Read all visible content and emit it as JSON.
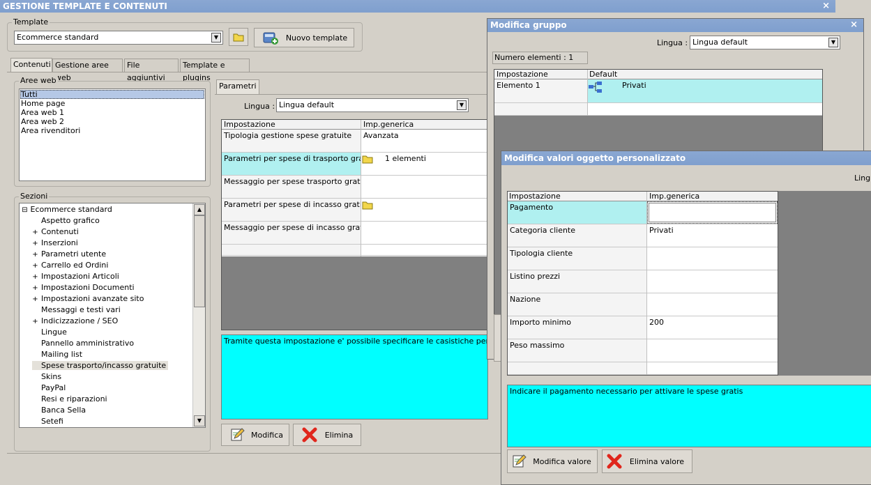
{
  "main": {
    "title": "GESTIONE TEMPLATE E CONTENUTI",
    "close": "×",
    "template_group_label": "Template",
    "template_value": "Ecommerce standard",
    "new_template_label": "Nuovo template",
    "tabs": [
      "Contenuti",
      "Gestione aree web",
      "File aggiuntivi",
      "Template e plugins"
    ],
    "aree_web_label": "Aree web",
    "aree_web": [
      "Tutti",
      "Home page",
      "Area web 1",
      "Area web 2",
      "Area rivenditori"
    ],
    "sezioni_label": "Sezioni",
    "tree_root": "Ecommerce standard",
    "tree": [
      {
        "label": "Aspetto grafico",
        "expandable": false
      },
      {
        "label": "Contenuti",
        "expandable": true
      },
      {
        "label": "Inserzioni",
        "expandable": true
      },
      {
        "label": "Parametri utente",
        "expandable": true
      },
      {
        "label": "Carrello ed Ordini",
        "expandable": true
      },
      {
        "label": "Impostazioni Articoli",
        "expandable": true
      },
      {
        "label": "Impostazioni Documenti",
        "expandable": true
      },
      {
        "label": "Impostazioni avanzate sito",
        "expandable": true
      },
      {
        "label": "Messaggi e testi vari",
        "expandable": false
      },
      {
        "label": "Indicizzazione / SEO",
        "expandable": true
      },
      {
        "label": "Lingue",
        "expandable": false
      },
      {
        "label": "Pannello amministrativo",
        "expandable": false
      },
      {
        "label": "Mailing list",
        "expandable": false
      },
      {
        "label": "Spese trasporto/incasso gratuite",
        "expandable": false
      },
      {
        "label": "Skins",
        "expandable": false
      },
      {
        "label": "PayPal",
        "expandable": false
      },
      {
        "label": "Resi e riparazioni",
        "expandable": false
      },
      {
        "label": "Banca Sella",
        "expandable": false
      },
      {
        "label": "Setefi",
        "expandable": false
      }
    ],
    "param_tab": "Parametri",
    "lingua_label": "Lingua :",
    "lingua_value": "Lingua default",
    "grid_headers": [
      "Impostazione",
      "Imp.generica"
    ],
    "grid_rows": [
      {
        "name": "Tipologia gestione spese gratuite",
        "value": "Avanzata"
      },
      {
        "name": "Parametri per spese di trasporto gratis",
        "value": "1 elementi"
      },
      {
        "name": "Messaggio per spese trasporto gratis",
        "value": ""
      },
      {
        "name": "Parametri per spese di incasso gratis",
        "value": ""
      },
      {
        "name": "Messaggio per spese di incasso gratis",
        "value": ""
      }
    ],
    "description": "Tramite questa impostazione e' possibile specificare le casistiche per l'attivazion",
    "modifica_label": "Modifica",
    "elimina_label": "Elimina"
  },
  "gruppo": {
    "title": "Modifica gruppo",
    "close": "×",
    "lingua_label": "Lingua :",
    "lingua_value": "Lingua default",
    "count_label": "Numero elementi : 1",
    "headers": [
      "Impostazione",
      "Default"
    ],
    "rows": [
      {
        "name": "Elemento 1",
        "value": "Privati"
      }
    ]
  },
  "oggetto": {
    "title": "Modifica valori oggetto personalizzato",
    "lingua_partial": "Lingu",
    "headers": [
      "Impostazione",
      "Imp.generica"
    ],
    "rows": [
      {
        "name": "Pagamento",
        "value": ""
      },
      {
        "name": "Categoria cliente",
        "value": "Privati"
      },
      {
        "name": "Tipologia cliente",
        "value": ""
      },
      {
        "name": "Listino prezzi",
        "value": ""
      },
      {
        "name": "Nazione",
        "value": ""
      },
      {
        "name": "Importo minimo",
        "value": "200"
      },
      {
        "name": "Peso massimo",
        "value": ""
      }
    ],
    "description": "Indicare il pagamento necessario per attivare le spese gratis",
    "modifica_valore_label": "Modifica valore",
    "elimina_valore_label": "Elimina valore"
  },
  "colors": {
    "titlebar": "#7f9fce",
    "highlight": "#b0f0f0",
    "description_bg": "#00ffff",
    "panel": "#d4d0c8"
  }
}
